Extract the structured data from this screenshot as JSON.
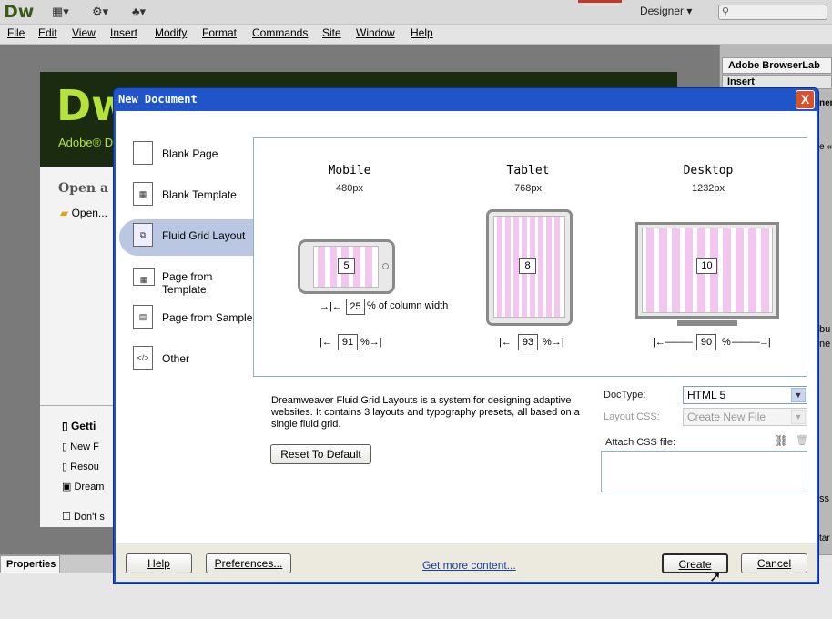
{
  "app": {
    "logo": "Dw",
    "workspace": "Designer",
    "menu": [
      "File",
      "Edit",
      "View",
      "Insert",
      "Modify",
      "Format",
      "Commands",
      "Site",
      "Window",
      "Help"
    ]
  },
  "background": {
    "welcome_logo": "Dw",
    "welcome_brand": "Adobe® D",
    "open_recent": "Open a R",
    "open_item": "Open...",
    "list_items": [
      "Getti",
      "New F",
      "Resou",
      "Dream"
    ],
    "dont_show": "Don't s",
    "panel_tabs": [
      "Adobe BrowserLab",
      "Insert"
    ],
    "properties_tab": "Properties",
    "right_snips": [
      "ner",
      "e «",
      "bu",
      "ne",
      "ss",
      "tar"
    ]
  },
  "dialog": {
    "title": "New Document",
    "close": "X",
    "categories": [
      {
        "label": "Blank Page",
        "icon": "blank-page-icon"
      },
      {
        "label": "Blank Template",
        "icon": "blank-template-icon"
      },
      {
        "label": "Fluid Grid Layout",
        "icon": "fluid-grid-icon"
      },
      {
        "label": "Page from Template",
        "icon": "page-from-template-icon"
      },
      {
        "label": "Page from Sample",
        "icon": "page-from-sample-icon"
      },
      {
        "label": "Other",
        "icon": "other-code-icon"
      }
    ],
    "devices": [
      {
        "name": "Mobile",
        "size": "480px",
        "columns": "5",
        "width_pct": "91"
      },
      {
        "name": "Tablet",
        "size": "768px",
        "columns": "8",
        "width_pct": "93"
      },
      {
        "name": "Desktop",
        "size": "1232px",
        "columns": "10",
        "width_pct": "90"
      }
    ],
    "gutter_value": "25",
    "gutter_label": "% of column width",
    "pct": "%",
    "description": "Dreamweaver Fluid Grid Layouts is a system for designing adaptive websites. It contains 3 layouts and typography presets, all based on a single fluid grid.",
    "reset_button": "Reset To Default",
    "doctype_label": "DocType:",
    "doctype_value": "HTML 5",
    "layout_css_label": "Layout CSS:",
    "layout_css_value": "Create New File",
    "attach_css_label": "Attach CSS file:",
    "buttons": {
      "help": "Help",
      "preferences": "Preferences...",
      "get_more": "Get more content...",
      "create": "Create",
      "cancel": "Cancel"
    }
  }
}
